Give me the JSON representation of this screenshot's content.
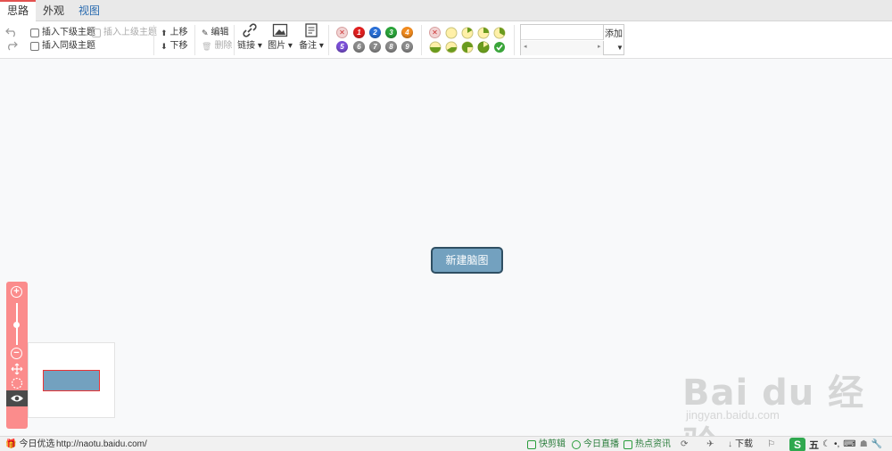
{
  "tabs": [
    {
      "label": "思路",
      "active": true
    },
    {
      "label": "外观",
      "active": false
    },
    {
      "label": "视图",
      "active": false
    }
  ],
  "toolbar": {
    "insert_child": "插入下级主题",
    "insert_parent": "插入上级主题",
    "insert_sibling": "插入同级主题",
    "move_up": "上移",
    "move_down": "下移",
    "edit": "编辑",
    "delete": "删除",
    "link": "链接",
    "image": "图片",
    "note": "备注",
    "priorities": [
      "1",
      "2",
      "3",
      "4",
      "5",
      "6",
      "7",
      "8",
      "9"
    ],
    "priority_colors": [
      "#e02020",
      "#2a6fd6",
      "#2aa43a",
      "#f08a1e",
      "#7a4fd6",
      "#8a8a8a",
      "#8a8a8a",
      "#8a8a8a",
      "#8a8a8a"
    ],
    "tag_placeholder": "",
    "tag_add": "添加"
  },
  "canvas": {
    "root_node": "新建脑图"
  },
  "zoom": {
    "zoom_in": "+",
    "zoom_out": "−"
  },
  "watermark": {
    "main": "Bai du 经验",
    "sub": "jingyan.baidu.com"
  },
  "statusbar": {
    "today_pick": "今日优选",
    "url": "http://naotu.baidu.com/",
    "quick_clip": "快剪辑",
    "live": "今日直播",
    "hot_news": "热点资讯",
    "download": "下载",
    "ime_label": "五"
  }
}
